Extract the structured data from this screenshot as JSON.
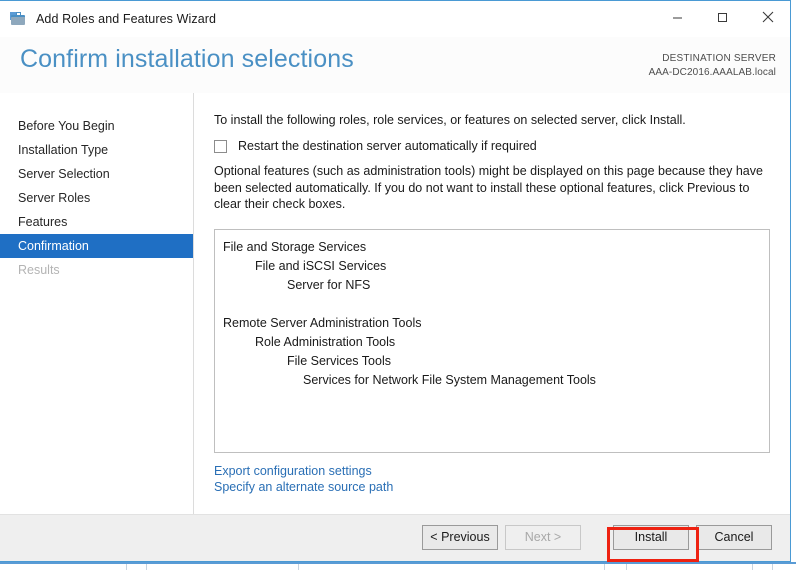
{
  "window": {
    "title": "Add Roles and Features Wizard",
    "icon": "wizard-toolbox-icon",
    "controls": {
      "minimize": "minimize-icon",
      "maximize": "maximize-icon",
      "close": "close-icon"
    }
  },
  "header": {
    "page_title": "Confirm installation selections",
    "destination_label": "DESTINATION SERVER",
    "destination_value": "AAA-DC2016.AAALAB.local"
  },
  "nav": {
    "items": [
      {
        "label": "Before You Begin",
        "state": "normal"
      },
      {
        "label": "Installation Type",
        "state": "normal"
      },
      {
        "label": "Server Selection",
        "state": "normal"
      },
      {
        "label": "Server Roles",
        "state": "normal"
      },
      {
        "label": "Features",
        "state": "normal"
      },
      {
        "label": "Confirmation",
        "state": "selected"
      },
      {
        "label": "Results",
        "state": "disabled"
      }
    ]
  },
  "content": {
    "intro": "To install the following roles, role services, or features on selected server, click Install.",
    "restart_checkbox": {
      "label": "Restart the destination server automatically if required",
      "checked": false
    },
    "optional_note": "Optional features (such as administration tools) might be displayed on this page because they have been selected automatically. If you do not want to install these optional features, click Previous to clear their check boxes.",
    "selection_tree": [
      {
        "label": "File and Storage Services",
        "level": 0
      },
      {
        "label": "File and iSCSI Services",
        "level": 1
      },
      {
        "label": "Server for NFS",
        "level": 2
      },
      {
        "label": "",
        "level": 0
      },
      {
        "label": "Remote Server Administration Tools",
        "level": 0
      },
      {
        "label": "Role Administration Tools",
        "level": 1
      },
      {
        "label": "File Services Tools",
        "level": 2
      },
      {
        "label": "Services for Network File System Management Tools",
        "level": 3
      }
    ],
    "links": [
      {
        "label": "Export configuration settings"
      },
      {
        "label": "Specify an alternate source path"
      }
    ]
  },
  "footer": {
    "buttons": [
      {
        "label": "< Previous",
        "state": "enabled"
      },
      {
        "label": "Next >",
        "state": "disabled"
      },
      {
        "label": "Install",
        "state": "enabled",
        "highlighted": true
      },
      {
        "label": "Cancel",
        "state": "enabled"
      }
    ]
  },
  "colors": {
    "accent_blue": "#4a90c4",
    "selection_blue": "#1f6fc4",
    "link_blue": "#2a6fb5",
    "highlight_red": "#ee2211",
    "window_border": "#4a9ad4",
    "footer_gray": "#efefef"
  }
}
